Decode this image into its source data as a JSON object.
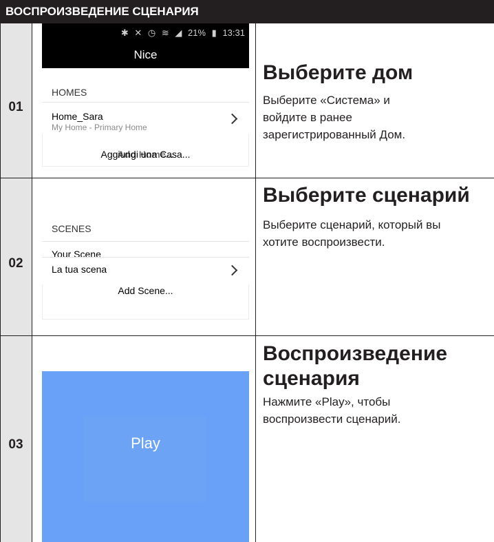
{
  "header": {
    "title": "ВОСПРОИЗВЕДЕНИЕ СЦЕНАРИЯ"
  },
  "steps": [
    {
      "number": "01",
      "title": "Выберите дом",
      "text_lines": [
        "Выберите «Система» и",
        "войдите в ранее",
        "зарегистрированный Дом."
      ]
    },
    {
      "number": "02",
      "title": "Выберите сценарий",
      "text_lines": [
        "Выберите сценарий, который вы",
        "хотите воспроизвести."
      ]
    },
    {
      "number": "03",
      "title_lines": [
        "Воспроизведение",
        "сценария"
      ],
      "text_lines": [
        "Нажмите «Play», чтобы",
        "воспроизвести сценарий."
      ]
    }
  ],
  "phone1": {
    "status_time": "13:31",
    "battery": "21%",
    "app_title": "Nice",
    "section_label": "HOMES",
    "item_name": "Home_Sara",
    "item_sub": "My Home - Primary Home",
    "add_text_a": "Aggiungi una Casa...",
    "add_text_b": "Add Home..."
  },
  "phone2": {
    "section_label": "SCENES",
    "item_name": "Your Scene",
    "item_sub": "La tua scena",
    "add_text": "Add Scene..."
  },
  "phone3": {
    "play_label": "Play",
    "colors": {
      "play_bg": "#68a1f7"
    }
  },
  "icons": [
    "bluetooth-icon",
    "mute-icon",
    "alarm-icon",
    "wifi-icon",
    "signal-icon",
    "battery-icon",
    "chevron-right-icon"
  ]
}
